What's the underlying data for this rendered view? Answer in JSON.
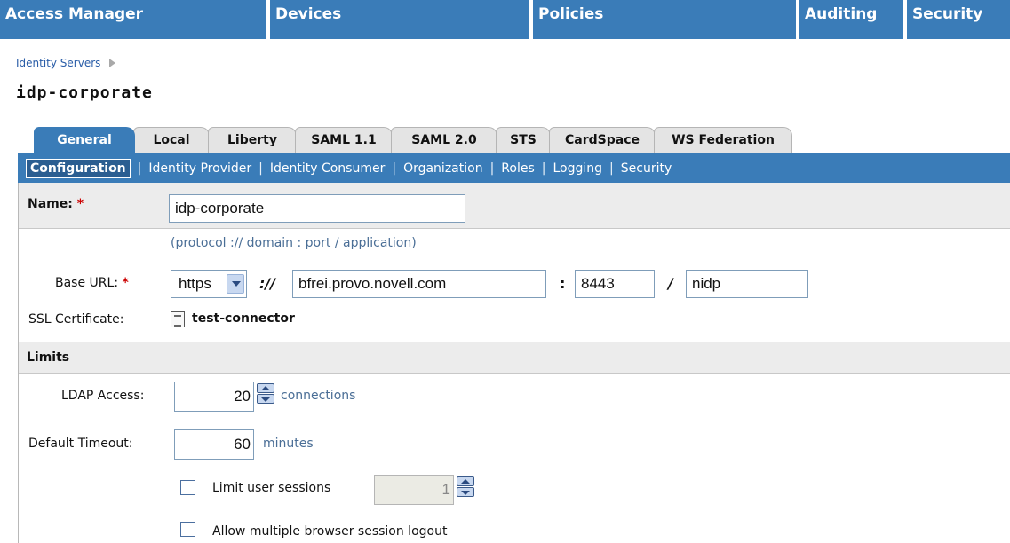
{
  "topnav": {
    "items": [
      {
        "label": "Access Manager"
      },
      {
        "label": "Devices"
      },
      {
        "label": "Policies"
      },
      {
        "label": "Auditing"
      },
      {
        "label": "Security"
      }
    ]
  },
  "breadcrumb": {
    "link": "Identity Servers"
  },
  "page": {
    "title": "idp-corporate"
  },
  "tabs": [
    {
      "label": "General",
      "active": true
    },
    {
      "label": "Local"
    },
    {
      "label": "Liberty"
    },
    {
      "label": "SAML 1.1"
    },
    {
      "label": "SAML 2.0"
    },
    {
      "label": "STS"
    },
    {
      "label": "CardSpace"
    },
    {
      "label": "WS Federation"
    }
  ],
  "subnav": {
    "active": "Configuration",
    "items": [
      "Identity Provider",
      "Identity Consumer",
      "Organization",
      "Roles",
      "Logging",
      "Security"
    ]
  },
  "form": {
    "name_label": "Name:",
    "required_mark": "*",
    "name_value": "idp-corporate",
    "url_hint": "(protocol :// domain : port / application)",
    "base_url_label": "Base URL:",
    "protocol_value": "https",
    "sep_scheme": "://",
    "domain_value": "bfrei.provo.novell.com",
    "sep_port": ":",
    "port_value": "8443",
    "sep_app": "/",
    "app_value": "nidp",
    "ssl_label": "SSL Certificate:",
    "ssl_value": "test-connector"
  },
  "limits": {
    "header": "Limits",
    "ldap_label": "LDAP Access:",
    "ldap_value": "20",
    "ldap_unit": "connections",
    "timeout_label": "Default Timeout:",
    "timeout_value": "60",
    "timeout_unit": "minutes",
    "limit_sessions_label": "Limit user sessions",
    "limit_sessions_value": "1",
    "limit_sessions_checked": false,
    "multi_logout_label": "Allow multiple browser session logout",
    "multi_logout_checked": false
  },
  "colors": {
    "brand_blue": "#3a7cb8",
    "required_red": "#cc0000",
    "hint_blue": "#4a6e96"
  }
}
